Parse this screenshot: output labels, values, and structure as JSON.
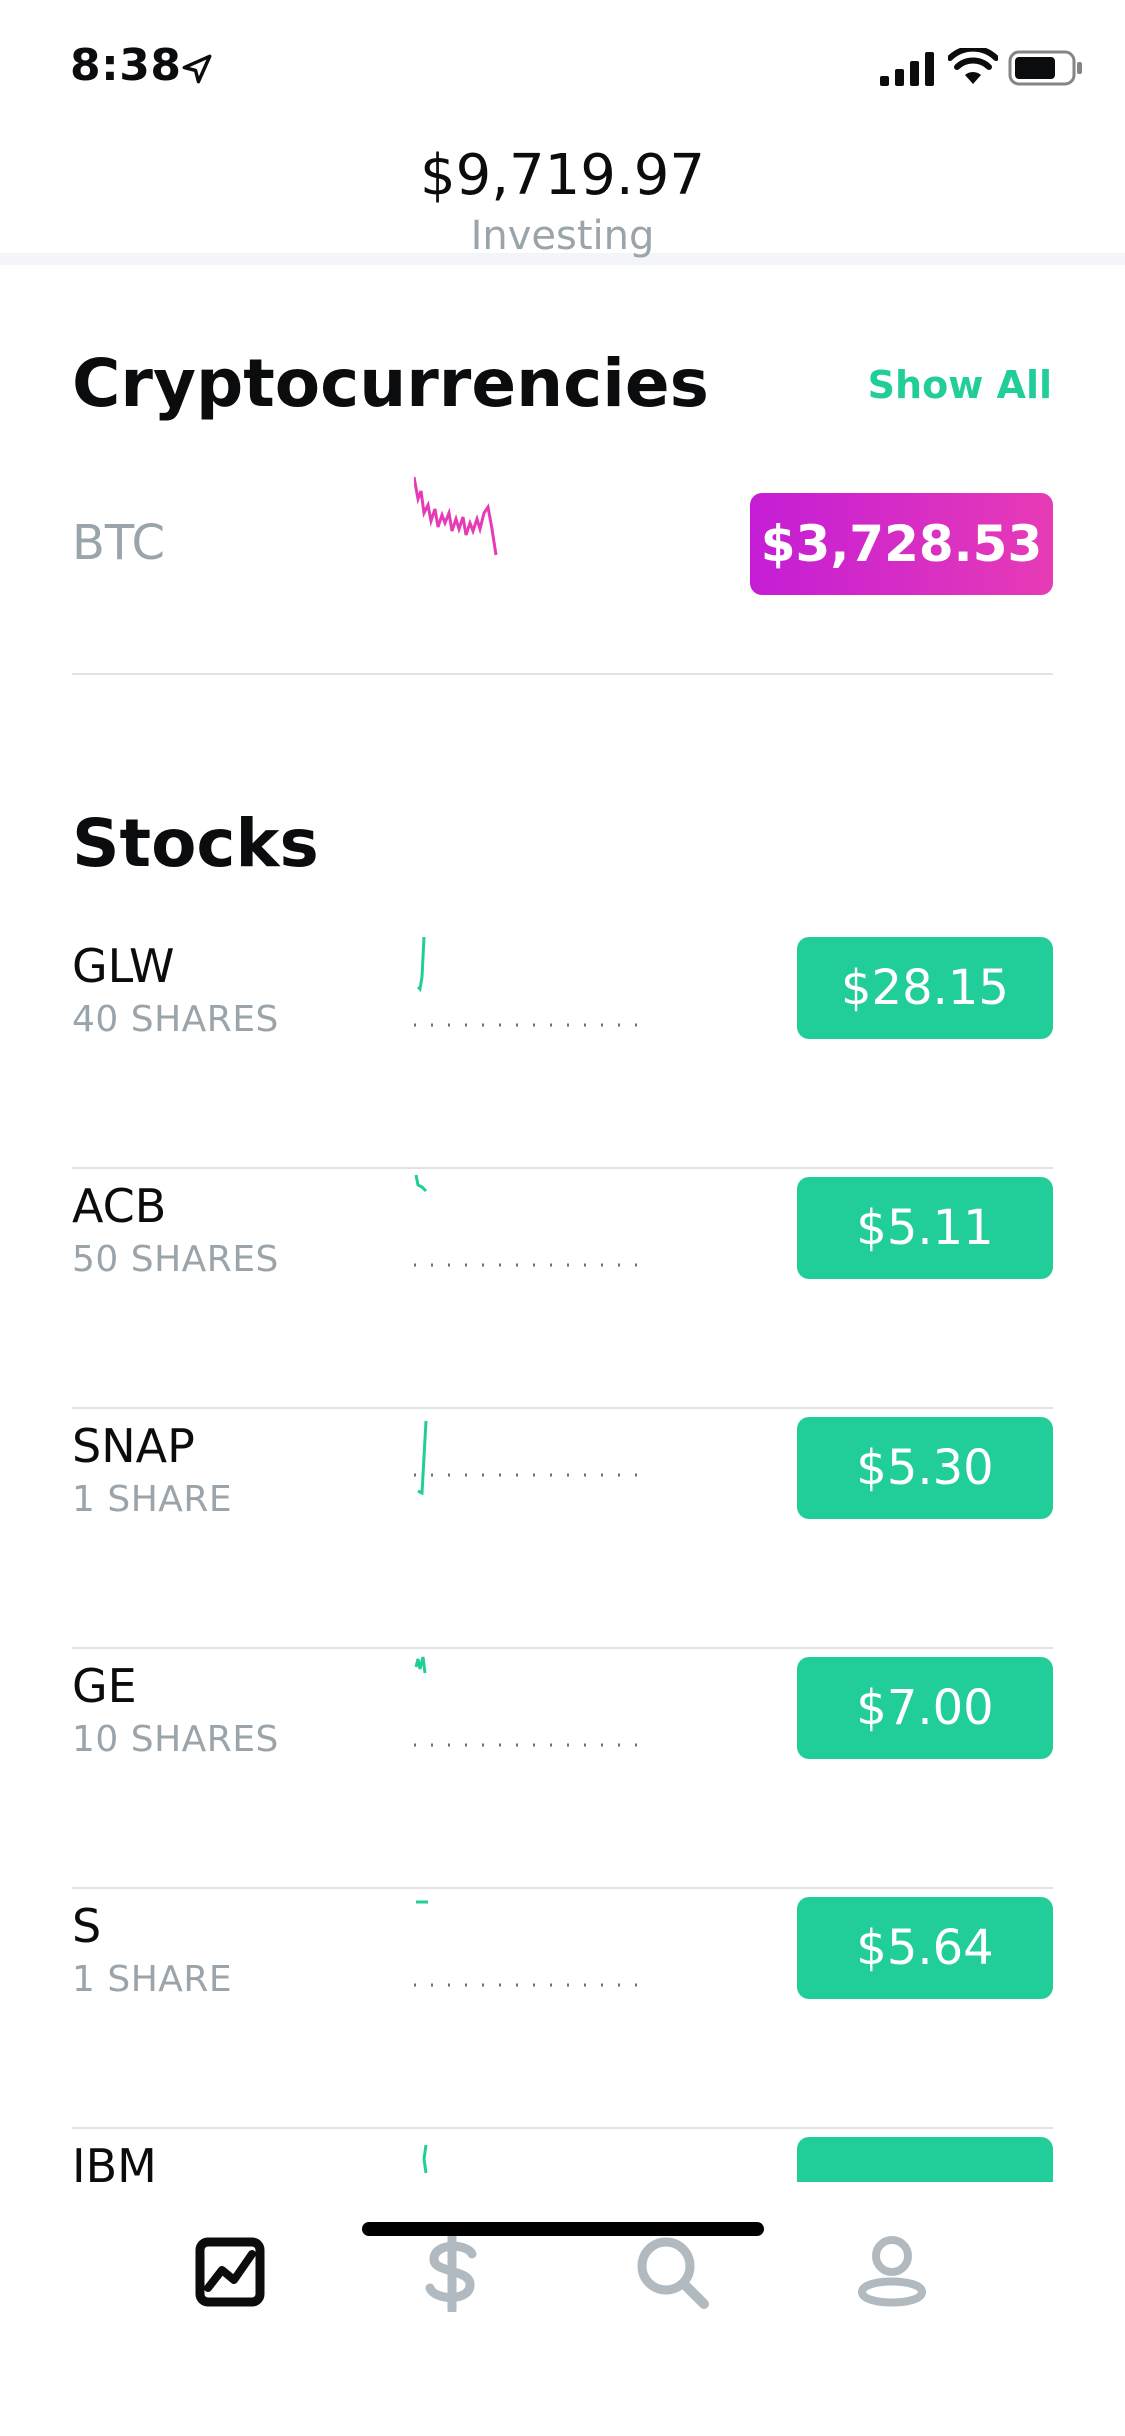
{
  "status_bar": {
    "time": "8:38"
  },
  "header": {
    "portfolio_value": "$9,719.97",
    "label": "Investing"
  },
  "crypto": {
    "title": "Cryptocurrencies",
    "show_all": "Show All",
    "items": [
      {
        "symbol": "BTC",
        "price": "$3,728.53"
      }
    ]
  },
  "stocks": {
    "title": "Stocks",
    "items": [
      {
        "symbol": "GLW",
        "shares": "40 SHARES",
        "price": "$28.15"
      },
      {
        "symbol": "ACB",
        "shares": "50 SHARES",
        "price": "$5.11"
      },
      {
        "symbol": "SNAP",
        "shares": "1 SHARE",
        "price": "$5.30"
      },
      {
        "symbol": "GE",
        "shares": "10 SHARES",
        "price": "$7.00"
      },
      {
        "symbol": "S",
        "shares": "1 SHARE",
        "price": "$5.64"
      },
      {
        "symbol": "IBM",
        "shares": "",
        "price": ""
      }
    ]
  },
  "tab_bar": {
    "tabs": [
      {
        "icon": "chart-icon",
        "active": true
      },
      {
        "icon": "dollar-icon",
        "active": false
      },
      {
        "icon": "search-icon",
        "active": false
      },
      {
        "icon": "account-icon",
        "active": false
      }
    ]
  },
  "colors": {
    "accent_green": "#21ce99",
    "crypto_magenta": "#d42ac9",
    "muted_text": "#9aa4ab"
  }
}
